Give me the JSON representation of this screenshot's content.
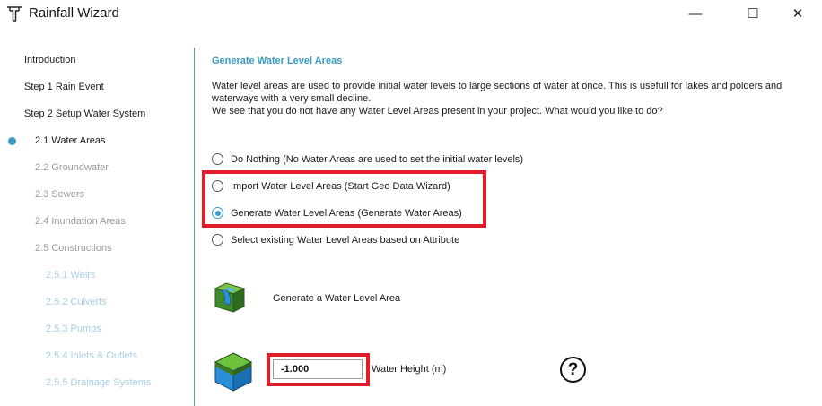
{
  "window": {
    "title": "Rainfall Wizard",
    "minimize_glyph": "—",
    "maximize_glyph": "☐",
    "close_glyph": "✕",
    "app_icon": "tee-junction-icon"
  },
  "sidebar": {
    "items": [
      {
        "label": "Introduction"
      },
      {
        "label": "Step 1 Rain Event"
      },
      {
        "label": "Step 2 Setup Water System"
      },
      {
        "label": "2.1 Water Areas"
      },
      {
        "label": "2.2 Groundwater"
      },
      {
        "label": "2.3 Sewers"
      },
      {
        "label": "2.4 Inundation Areas"
      },
      {
        "label": "2.5 Constructions"
      },
      {
        "label": "2.5.1 Weirs"
      },
      {
        "label": "2.5.2 Culverts"
      },
      {
        "label": "2.5.3 Pumps"
      },
      {
        "label": "2.5.4 Inlets & Outlets"
      },
      {
        "label": "2.5.5 Drainage Systems"
      }
    ],
    "active_label": "2.1 Water Areas"
  },
  "main": {
    "heading": "Generate Water Level Areas",
    "description_line1": "Water level areas are used to provide initial water levels to large sections of water at once. This is usefull for lakes and polders and waterways with a very small decline.",
    "description_line2": "We see that you do not have any Water Level Areas present in your project. What would you like to do?",
    "options": [
      {
        "label": "Do Nothing (No Water Areas are used to set the initial water levels)",
        "selected": false
      },
      {
        "label": "Import Water Level Areas (Start Geo Data Wizard)",
        "selected": false
      },
      {
        "label": "Generate Water Level Areas (Generate Water Areas)",
        "selected": true
      },
      {
        "label": "Select existing Water Level Areas based on Attribute",
        "selected": false
      }
    ],
    "generate_label": "Generate a Water Level Area",
    "water_height_value": "-1.000",
    "water_height_label": "Water Height (m)",
    "help_glyph": "?"
  },
  "colors": {
    "accent": "#3a9bc4",
    "highlight_box": "#e11d2a",
    "inactive_text": "#9a9a9a",
    "disabled_text": "#a8cfe0"
  }
}
